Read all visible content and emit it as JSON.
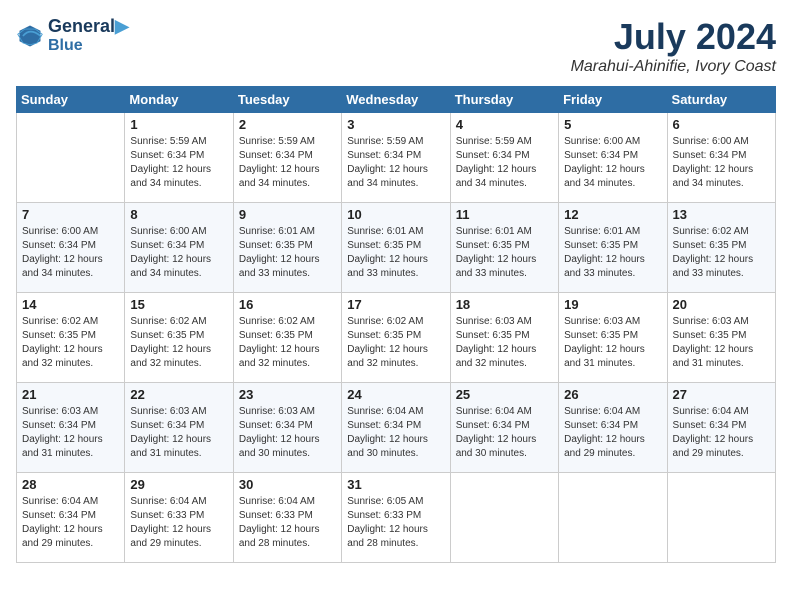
{
  "header": {
    "logo_line1": "General",
    "logo_line2": "Blue",
    "month_year": "July 2024",
    "location": "Marahui-Ahinifie, Ivory Coast"
  },
  "days_of_week": [
    "Sunday",
    "Monday",
    "Tuesday",
    "Wednesday",
    "Thursday",
    "Friday",
    "Saturday"
  ],
  "weeks": [
    [
      {
        "day": "",
        "info": ""
      },
      {
        "day": "1",
        "info": "Sunrise: 5:59 AM\nSunset: 6:34 PM\nDaylight: 12 hours\nand 34 minutes."
      },
      {
        "day": "2",
        "info": "Sunrise: 5:59 AM\nSunset: 6:34 PM\nDaylight: 12 hours\nand 34 minutes."
      },
      {
        "day": "3",
        "info": "Sunrise: 5:59 AM\nSunset: 6:34 PM\nDaylight: 12 hours\nand 34 minutes."
      },
      {
        "day": "4",
        "info": "Sunrise: 5:59 AM\nSunset: 6:34 PM\nDaylight: 12 hours\nand 34 minutes."
      },
      {
        "day": "5",
        "info": "Sunrise: 6:00 AM\nSunset: 6:34 PM\nDaylight: 12 hours\nand 34 minutes."
      },
      {
        "day": "6",
        "info": "Sunrise: 6:00 AM\nSunset: 6:34 PM\nDaylight: 12 hours\nand 34 minutes."
      }
    ],
    [
      {
        "day": "7",
        "info": "Sunrise: 6:00 AM\nSunset: 6:34 PM\nDaylight: 12 hours\nand 34 minutes."
      },
      {
        "day": "8",
        "info": "Sunrise: 6:00 AM\nSunset: 6:34 PM\nDaylight: 12 hours\nand 34 minutes."
      },
      {
        "day": "9",
        "info": "Sunrise: 6:01 AM\nSunset: 6:35 PM\nDaylight: 12 hours\nand 33 minutes."
      },
      {
        "day": "10",
        "info": "Sunrise: 6:01 AM\nSunset: 6:35 PM\nDaylight: 12 hours\nand 33 minutes."
      },
      {
        "day": "11",
        "info": "Sunrise: 6:01 AM\nSunset: 6:35 PM\nDaylight: 12 hours\nand 33 minutes."
      },
      {
        "day": "12",
        "info": "Sunrise: 6:01 AM\nSunset: 6:35 PM\nDaylight: 12 hours\nand 33 minutes."
      },
      {
        "day": "13",
        "info": "Sunrise: 6:02 AM\nSunset: 6:35 PM\nDaylight: 12 hours\nand 33 minutes."
      }
    ],
    [
      {
        "day": "14",
        "info": "Sunrise: 6:02 AM\nSunset: 6:35 PM\nDaylight: 12 hours\nand 32 minutes."
      },
      {
        "day": "15",
        "info": "Sunrise: 6:02 AM\nSunset: 6:35 PM\nDaylight: 12 hours\nand 32 minutes."
      },
      {
        "day": "16",
        "info": "Sunrise: 6:02 AM\nSunset: 6:35 PM\nDaylight: 12 hours\nand 32 minutes."
      },
      {
        "day": "17",
        "info": "Sunrise: 6:02 AM\nSunset: 6:35 PM\nDaylight: 12 hours\nand 32 minutes."
      },
      {
        "day": "18",
        "info": "Sunrise: 6:03 AM\nSunset: 6:35 PM\nDaylight: 12 hours\nand 32 minutes."
      },
      {
        "day": "19",
        "info": "Sunrise: 6:03 AM\nSunset: 6:35 PM\nDaylight: 12 hours\nand 31 minutes."
      },
      {
        "day": "20",
        "info": "Sunrise: 6:03 AM\nSunset: 6:35 PM\nDaylight: 12 hours\nand 31 minutes."
      }
    ],
    [
      {
        "day": "21",
        "info": "Sunrise: 6:03 AM\nSunset: 6:34 PM\nDaylight: 12 hours\nand 31 minutes."
      },
      {
        "day": "22",
        "info": "Sunrise: 6:03 AM\nSunset: 6:34 PM\nDaylight: 12 hours\nand 31 minutes."
      },
      {
        "day": "23",
        "info": "Sunrise: 6:03 AM\nSunset: 6:34 PM\nDaylight: 12 hours\nand 30 minutes."
      },
      {
        "day": "24",
        "info": "Sunrise: 6:04 AM\nSunset: 6:34 PM\nDaylight: 12 hours\nand 30 minutes."
      },
      {
        "day": "25",
        "info": "Sunrise: 6:04 AM\nSunset: 6:34 PM\nDaylight: 12 hours\nand 30 minutes."
      },
      {
        "day": "26",
        "info": "Sunrise: 6:04 AM\nSunset: 6:34 PM\nDaylight: 12 hours\nand 29 minutes."
      },
      {
        "day": "27",
        "info": "Sunrise: 6:04 AM\nSunset: 6:34 PM\nDaylight: 12 hours\nand 29 minutes."
      }
    ],
    [
      {
        "day": "28",
        "info": "Sunrise: 6:04 AM\nSunset: 6:34 PM\nDaylight: 12 hours\nand 29 minutes."
      },
      {
        "day": "29",
        "info": "Sunrise: 6:04 AM\nSunset: 6:33 PM\nDaylight: 12 hours\nand 29 minutes."
      },
      {
        "day": "30",
        "info": "Sunrise: 6:04 AM\nSunset: 6:33 PM\nDaylight: 12 hours\nand 28 minutes."
      },
      {
        "day": "31",
        "info": "Sunrise: 6:05 AM\nSunset: 6:33 PM\nDaylight: 12 hours\nand 28 minutes."
      },
      {
        "day": "",
        "info": ""
      },
      {
        "day": "",
        "info": ""
      },
      {
        "day": "",
        "info": ""
      }
    ]
  ]
}
